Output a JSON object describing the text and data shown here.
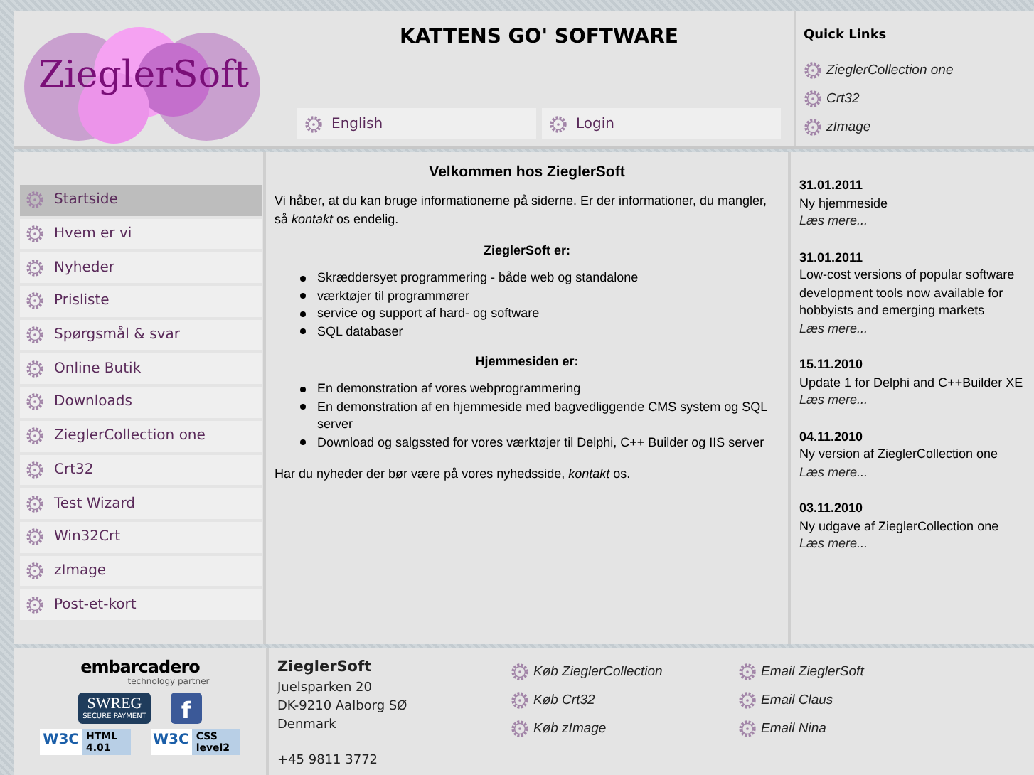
{
  "header": {
    "logo": "ZieglerSoft",
    "title": "KATTENS GO' SOFTWARE",
    "buttons": [
      "English",
      "Login"
    ]
  },
  "quick_links": {
    "title": "Quick Links",
    "items": [
      "ZieglerCollection one",
      "Crt32",
      "zImage"
    ]
  },
  "sidebar": {
    "items": [
      {
        "label": "Startside",
        "selected": true
      },
      {
        "label": "Hvem er vi",
        "selected": false
      },
      {
        "label": "Nyheder",
        "selected": false
      },
      {
        "label": "Prisliste",
        "selected": false
      },
      {
        "label": "Spørgsmål & svar",
        "selected": false
      },
      {
        "label": "Online Butik",
        "selected": false
      },
      {
        "label": "Downloads",
        "selected": false
      },
      {
        "label": "ZieglerCollection one",
        "selected": false
      },
      {
        "label": "Crt32",
        "selected": false
      },
      {
        "label": "Test Wizard",
        "selected": false
      },
      {
        "label": "Win32Crt",
        "selected": false
      },
      {
        "label": "zImage",
        "selected": false
      },
      {
        "label": "Post-et-kort",
        "selected": false
      }
    ]
  },
  "content": {
    "heading": "Velkommen hos ZieglerSoft",
    "intro": "Vi håber, at du kan bruge informationerne på siderne. Er der informationer, du mangler, så *kontakt* os endelig.",
    "sections": [
      {
        "heading": "ZieglerSoft er:",
        "items": [
          "Skræddersyet programmering - både web og standalone",
          "værktøjer til programmører",
          "service og support af hard- og software",
          "SQL databaser"
        ]
      },
      {
        "heading": "Hjemmesiden er:",
        "items": [
          "En demonstration af vores webprogrammering",
          "En demonstration af en hjemmeside med bagvedliggende CMS system og SQL server",
          "Download og salgssted for vores værktøjer til Delphi, C++ Builder og IIS server"
        ]
      }
    ],
    "outro": "Har du nyheder der bør være på vores nyhedsside, *kontakt* os."
  },
  "news": [
    {
      "date": "31.01.2011",
      "text": "Ny hjemmeside",
      "link": "Læs mere..."
    },
    {
      "date": "31.01.2011",
      "text": "Low-cost versions of popular software development tools now available for hobbyists and emerging markets",
      "link": "Læs mere..."
    },
    {
      "date": "15.11.2010",
      "text": "Update 1 for Delphi and C++Builder XE",
      "link": "Læs mere..."
    },
    {
      "date": "04.11.2010",
      "text": "Ny version af ZieglerCollection one",
      "link": "Læs mere..."
    },
    {
      "date": "03.11.2010",
      "text": "Ny udgave af ZieglerCollection one",
      "link": "Læs mere..."
    }
  ],
  "footer": {
    "badges": {
      "embarcadero": "embarcadero",
      "embarcadero_sub": "technology partner",
      "swreg": "SWREG",
      "swreg_sub": "SECURE PAYMENT",
      "facebook": "f",
      "w3c": [
        "W3C",
        "W3C"
      ],
      "html": "HTML 4.01",
      "css": "CSS level2"
    },
    "company": "ZieglerSoft",
    "address": [
      "Juelsparken 20",
      "DK-9210 Aalborg SØ",
      "Denmark"
    ],
    "phone": "+45 9811 3772",
    "buy_links": [
      "Køb ZieglerCollection",
      "Køb Crt32",
      "Køb zImage"
    ],
    "email_links": [
      "Email ZieglerSoft",
      "Email Claus",
      "Email Nina"
    ]
  }
}
